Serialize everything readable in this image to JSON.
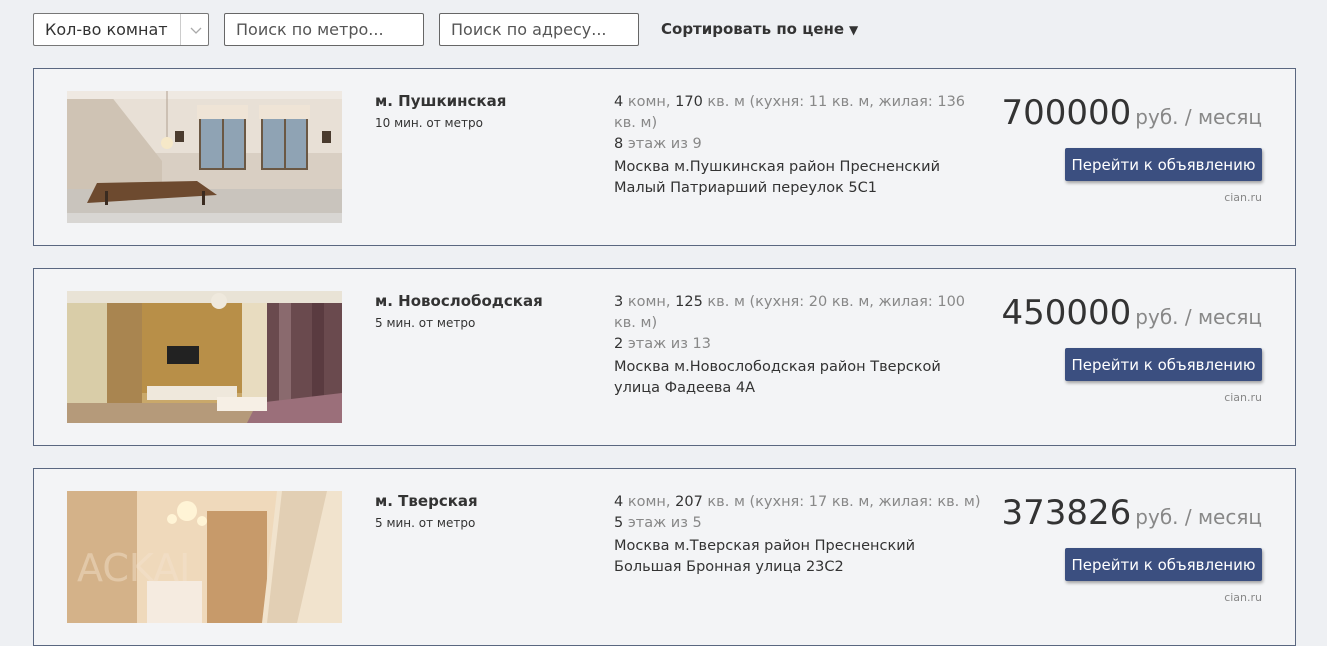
{
  "filters": {
    "rooms_select": "Кол-во комнат",
    "metro_placeholder": "Поиск по метро...",
    "address_placeholder": "Поиск по адресу...",
    "sort_label": "Сортировать по цене",
    "sort_arrow": "▼"
  },
  "listings": [
    {
      "metro": "м. Пушкинская",
      "walk": "10 мин. от метро",
      "rooms": "4",
      "rooms_unit": " комн, ",
      "area": "170",
      "area_rest": " кв. м (кухня: 11 кв. м, жилая: 136 кв. м)",
      "floor": "8",
      "floor_rest": " этаж из 9",
      "address": "Москва м.Пушкинская район Пресненский Малый Патриарший переулок 5С1",
      "price": "700000",
      "price_unit": "руб. / месяц",
      "button": "Перейти к объявлению",
      "source": "cian.ru"
    },
    {
      "metro": "м. Новослободская",
      "walk": "5 мин. от метро",
      "rooms": "3",
      "rooms_unit": " комн, ",
      "area": "125",
      "area_rest": " кв. м (кухня: 20 кв. м, жилая: 100 кв. м)",
      "floor": "2",
      "floor_rest": " этаж из 13",
      "address": "Москва м.Новослободская район Тверской улица Фадеева 4А",
      "price": "450000",
      "price_unit": "руб. / месяц",
      "button": "Перейти к объявлению",
      "source": "cian.ru"
    },
    {
      "metro": "м. Тверская",
      "walk": "5 мин. от метро",
      "rooms": "4",
      "rooms_unit": " комн, ",
      "area": "207",
      "area_rest": " кв. м (кухня: 17 кв. м, жилая: кв. м)",
      "floor": "5",
      "floor_rest": " этаж из 5",
      "address": "Москва м.Тверская район Пресненский Большая Бронная улица 23С2",
      "price": "373826",
      "price_unit": "руб. / месяц",
      "button": "Перейти к объявлению",
      "source": "cian.ru"
    }
  ]
}
